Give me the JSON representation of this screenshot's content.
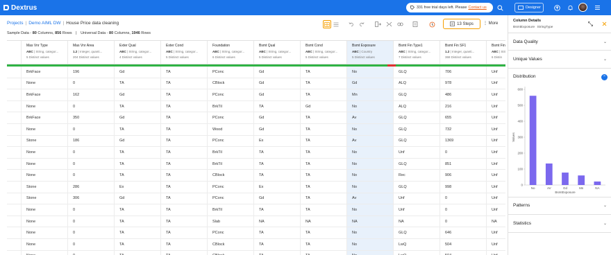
{
  "brand": {
    "name": "Dextrus",
    "accent": "#1a73e8",
    "highlight": "#f59f00"
  },
  "topbar": {
    "trial_text": "331 free trial days left. Please",
    "trial_link": "Contact us",
    "designer_label": "Designer",
    "icons": [
      "tag-icon",
      "search-icon",
      "designer-icon",
      "upload-icon",
      "bell-icon",
      "user-avatar",
      "menu-icon"
    ]
  },
  "breadcrumb": {
    "projects": "Projects",
    "project": "Demo AIML DW",
    "page": "House Price data cleaning"
  },
  "sample_info": {
    "prefix": "Sample Data - ",
    "sample_columns": "80",
    "columns_word": " Columns, ",
    "sample_rows": "856",
    "rows_word": " Rows",
    "divider": "|",
    "universal_prefix": "Universal Data - ",
    "universal_columns": "80",
    "universal_rows": "1946"
  },
  "toolbar": {
    "steps_label": "13 Steps",
    "more_label": "More"
  },
  "grid": {
    "columns": [
      {
        "name": "",
        "type_code": "",
        "type_desc": "",
        "distinct": ""
      },
      {
        "name": "Mas Vnr Type",
        "type_code": "ABC",
        "type_desc": "String, categor...",
        "distinct": "5 Distinct values"
      },
      {
        "name": "Mas Vnr Area",
        "type_code": "1.2",
        "type_desc": "Integer, quanti...",
        "distinct": "204 Distinct values"
      },
      {
        "name": "Exter Qual",
        "type_code": "ABC",
        "type_desc": "String, categor...",
        "distinct": "4 Distinct values"
      },
      {
        "name": "Exter Cond",
        "type_code": "ABC",
        "type_desc": "String, categor...",
        "distinct": "5 Distinct values"
      },
      {
        "name": "Foundation",
        "type_code": "ABC",
        "type_desc": "String, categor...",
        "distinct": "6 Distinct values"
      },
      {
        "name": "Bsmt Qual",
        "type_code": "ABC",
        "type_desc": "String, categor...",
        "distinct": "5 Distinct values"
      },
      {
        "name": "Bsmt Cond",
        "type_code": "ABC",
        "type_desc": "String, categor...",
        "distinct": "5 Distinct values"
      },
      {
        "name": "Bsmt Exposure",
        "type_code": "ABC",
        "type_desc": "Country",
        "distinct": "5 Distinct values"
      },
      {
        "name": "Bsmt Fin Type1",
        "type_code": "ABC",
        "type_desc": "String, categor...",
        "distinct": "7 Distinct values"
      },
      {
        "name": "Bsmt Fin SF1",
        "type_code": "1.2",
        "type_desc": "Integer, quanti...",
        "distinct": "368 Distinct values"
      },
      {
        "name": "Bsmt Fin",
        "type_code": "ABC",
        "type_desc": "String",
        "distinct": "6 Distin"
      }
    ],
    "rows": [
      [
        "",
        "BrkFace",
        "196",
        "Gd",
        "TA",
        "PConc",
        "Gd",
        "TA",
        "No",
        "GLQ",
        "706",
        "Unf"
      ],
      [
        "",
        "None",
        "0",
        "TA",
        "TA",
        "CBlock",
        "Gd",
        "TA",
        "Gd",
        "ALQ",
        "978",
        "Unf"
      ],
      [
        "",
        "BrkFace",
        "162",
        "Gd",
        "TA",
        "PConc",
        "Gd",
        "TA",
        "Mn",
        "GLQ",
        "486",
        "Unf"
      ],
      [
        "",
        "None",
        "0",
        "TA",
        "TA",
        "BrkTil",
        "TA",
        "Gd",
        "No",
        "ALQ",
        "216",
        "Unf"
      ],
      [
        "",
        "BrkFace",
        "350",
        "Gd",
        "TA",
        "PConc",
        "Gd",
        "TA",
        "Av",
        "GLQ",
        "655",
        "Unf"
      ],
      [
        "",
        "None",
        "0",
        "TA",
        "TA",
        "Wood",
        "Gd",
        "TA",
        "No",
        "GLQ",
        "732",
        "Unf"
      ],
      [
        "",
        "Stone",
        "186",
        "Gd",
        "TA",
        "PConc",
        "Ex",
        "TA",
        "Av",
        "GLQ",
        "1369",
        "Unf"
      ],
      [
        "",
        "None",
        "0",
        "TA",
        "TA",
        "BrkTil",
        "TA",
        "TA",
        "No",
        "Unf",
        "0",
        "Unf"
      ],
      [
        "",
        "None",
        "0",
        "TA",
        "TA",
        "BrkTil",
        "TA",
        "TA",
        "No",
        "GLQ",
        "851",
        "Unf"
      ],
      [
        "",
        "None",
        "0",
        "TA",
        "TA",
        "CBlock",
        "TA",
        "TA",
        "No",
        "Rec",
        "906",
        "Unf"
      ],
      [
        "",
        "Stone",
        "286",
        "Ex",
        "TA",
        "PConc",
        "Ex",
        "TA",
        "No",
        "GLQ",
        "998",
        "Unf"
      ],
      [
        "",
        "Stone",
        "306",
        "Gd",
        "TA",
        "PConc",
        "Gd",
        "TA",
        "Av",
        "Unf",
        "0",
        "Unf"
      ],
      [
        "",
        "None",
        "0",
        "TA",
        "TA",
        "BrkTil",
        "TA",
        "TA",
        "No",
        "Unf",
        "0",
        "Unf"
      ],
      [
        "",
        "None",
        "0",
        "TA",
        "TA",
        "Slab",
        "NA",
        "NA",
        "NA",
        "NA",
        "0",
        "NA"
      ],
      [
        "",
        "None",
        "0",
        "TA",
        "TA",
        "PConc",
        "TA",
        "TA",
        "No",
        "GLQ",
        "646",
        "Unf"
      ],
      [
        "",
        "None",
        "0",
        "TA",
        "TA",
        "CBlock",
        "TA",
        "TA",
        "No",
        "LwQ",
        "504",
        "Unf"
      ],
      [
        "",
        "None",
        "0",
        "TA",
        "TA",
        "CBlock",
        "TA",
        "TA",
        "No",
        "LwQ",
        "504",
        "Unf"
      ]
    ],
    "selected_column": "Bsmt Exposure",
    "quality_colors": {
      "valid": "#2fb344",
      "invalid": "#e03131"
    }
  },
  "panel": {
    "title": "Column Details",
    "column_name": "BsmtExposure",
    "column_type": "StringType",
    "sections": {
      "data_quality": "Data Quality",
      "unique_values": "Unique Values",
      "distribution": "Distribution",
      "patterns": "Patterns",
      "statistics": "Statistics"
    }
  },
  "chart_data": {
    "type": "bar",
    "categories": [
      "No",
      "AV",
      "Gd",
      "Mn",
      "NA"
    ],
    "values": [
      560,
      135,
      78,
      60,
      22
    ],
    "xlabel": "BsmtExposure",
    "ylabel": "Values",
    "ylim": [
      0,
      600
    ],
    "yticks": [
      0,
      100,
      200,
      300,
      400,
      500,
      600
    ],
    "bar_color": "#7b68ee",
    "grid": false,
    "legend": "none"
  }
}
